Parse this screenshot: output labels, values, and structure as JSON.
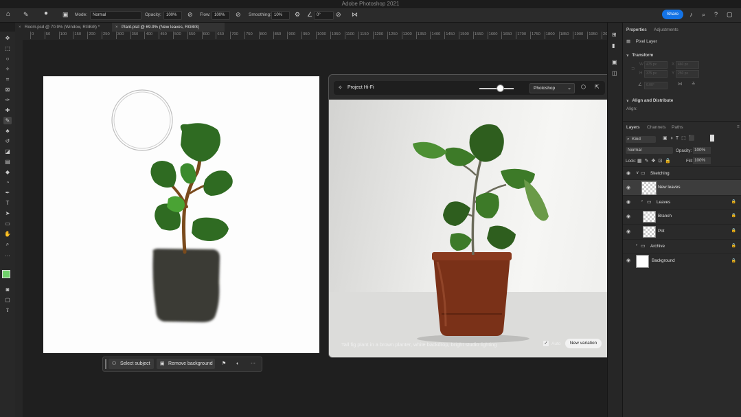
{
  "app": {
    "title": "Adobe Photoshop 2021",
    "share_label": "Share"
  },
  "options_bar": {
    "mode_label": "Mode:",
    "mode_value": "Normal",
    "opacity_label": "Opacity:",
    "opacity_value": "100%",
    "flow_label": "Flow:",
    "flow_value": "100%",
    "smoothing_label": "Smoothing:",
    "smoothing_value": "10%",
    "angle_value": "0°"
  },
  "tabs": [
    {
      "label": "Room.psd @ 70.9% (Window, RGB/8) *"
    },
    {
      "label": "Plant.psd @ 69.9% (New leaves, RGB/8)"
    }
  ],
  "ruler_ticks": [
    "0",
    "50",
    "100",
    "150",
    "200",
    "250",
    "300",
    "350",
    "400",
    "450",
    "500",
    "550",
    "600",
    "650",
    "700",
    "750",
    "800",
    "850",
    "900",
    "950",
    "1000",
    "1050",
    "1100",
    "1150",
    "1200",
    "1250",
    "1300",
    "1350",
    "1400",
    "1450",
    "1500",
    "1550",
    "1600",
    "1650",
    "1700",
    "1750",
    "1800",
    "1850",
    "1900",
    "1950",
    "2000"
  ],
  "context_bar": {
    "select_subject": "Select subject",
    "remove_background": "Remove background"
  },
  "hifi": {
    "title": "Project Hi-Fi",
    "source": "Photoshop",
    "slider_value": 0.6,
    "prompt": "Tall fig plant in a brown planter, white backdrop, bright studio lighting",
    "auto_label": "Auto",
    "new_variation_label": "New variation"
  },
  "properties": {
    "tab_properties": "Properties",
    "tab_adjustments": "Adjustments",
    "layer_type": "Pixel Layer",
    "transform_label": "Transform",
    "w_label": "W",
    "h_label": "H",
    "x_label": "X",
    "y_label": "Y",
    "w_value": "475 px",
    "h_value": "375 px",
    "x_value": "460 px",
    "y_value": "250 px",
    "angle_value": "0.00°",
    "align_label": "Align and Distribute",
    "align_sub": "Align:"
  },
  "layers_panel": {
    "tab_layers": "Layers",
    "tab_channels": "Channels",
    "tab_paths": "Paths",
    "kind_label": "Kind",
    "blend_mode": "Normal",
    "opacity_label": "Opacity:",
    "opacity_value": "100%",
    "lock_label": "Lock:",
    "fill_label": "Fill:",
    "fill_value": "100%",
    "layers": [
      {
        "name": "Sketching",
        "type": "group",
        "indent": 0
      },
      {
        "name": "New leaves",
        "type": "pixel",
        "indent": 1
      },
      {
        "name": "Leaves",
        "type": "group",
        "indent": 1
      },
      {
        "name": "Branch",
        "type": "pixel",
        "indent": 1
      },
      {
        "name": "Pot",
        "type": "pixel",
        "indent": 1
      },
      {
        "name": "Archive",
        "type": "group",
        "indent": 0
      },
      {
        "name": "Background",
        "type": "background",
        "indent": 0
      }
    ]
  },
  "colors": {
    "accent": "#1473e6",
    "foreground_swatch": "#6fd06a",
    "background_swatch": "#1a1a1a"
  }
}
